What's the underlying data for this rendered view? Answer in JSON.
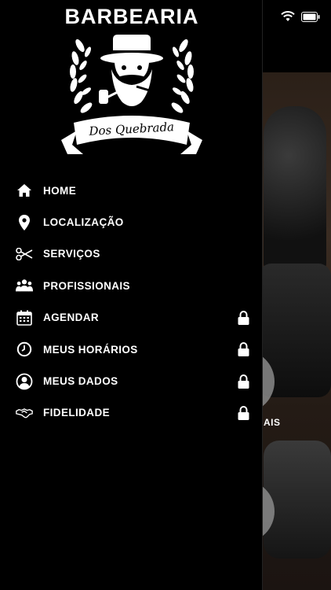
{
  "brand": {
    "title": "BARBEARIA",
    "subtitle": "Dos Quebrada"
  },
  "menu": {
    "items": [
      {
        "label": "HOME",
        "icon": "home-icon",
        "locked": false
      },
      {
        "label": "LOCALIZAÇÃO",
        "icon": "location-pin-icon",
        "locked": false
      },
      {
        "label": "SERVIÇOS",
        "icon": "scissors-icon",
        "locked": false
      },
      {
        "label": "PROFISSIONAIS",
        "icon": "people-icon",
        "locked": false
      },
      {
        "label": "AGENDAR",
        "icon": "calendar-icon",
        "locked": true
      },
      {
        "label": "MEUS HORÁRIOS",
        "icon": "clock-icon",
        "locked": true
      },
      {
        "label": "MEUS DADOS",
        "icon": "user-circle-icon",
        "locked": true
      },
      {
        "label": "FIDELIDADE",
        "icon": "handshake-icon",
        "locked": true
      }
    ]
  },
  "background": {
    "partial_label": "AIS"
  },
  "colors": {
    "drawer_bg": "#000000",
    "text": "#ffffff"
  }
}
